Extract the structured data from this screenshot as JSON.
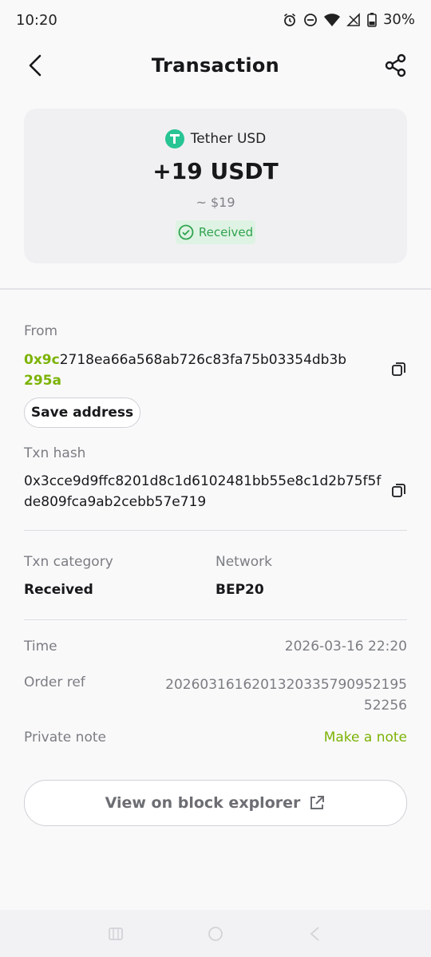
{
  "status_bar": {
    "time": "10:20",
    "battery": "30%"
  },
  "header": {
    "title": "Transaction"
  },
  "summary": {
    "token_name": "Tether USD",
    "amount": "+19 USDT",
    "fiat": "~ $19",
    "status": "Received",
    "colors": {
      "token": "#27c494",
      "status_bg": "#dff3e4",
      "status_text": "#2fa34f"
    }
  },
  "from": {
    "label": "From",
    "address_prefix": "0x9c",
    "address_middle": "2718ea66a568ab726c83fa75b03354db3b",
    "address_suffix": "295a",
    "save_label": "Save address"
  },
  "txn_hash": {
    "label": "Txn hash",
    "line1": "0x3cce9d9ffc8201d8c1d6102481bb55e8c1d2b75f5f",
    "line2": "de809fca9ab2cebb57e719"
  },
  "details": {
    "category_label": "Txn category",
    "category_value": "Received",
    "network_label": "Network",
    "network_value": "BEP20",
    "time_label": "Time",
    "time_value": "2026-03-16 22:20",
    "order_label": "Order ref",
    "order_line1": "20260316162013203357909521​95",
    "order_line2": "52256",
    "note_label": "Private note",
    "note_action": "Make a note"
  },
  "explorer": {
    "label": "View on block explorer"
  },
  "accent_color": "#7cb305"
}
